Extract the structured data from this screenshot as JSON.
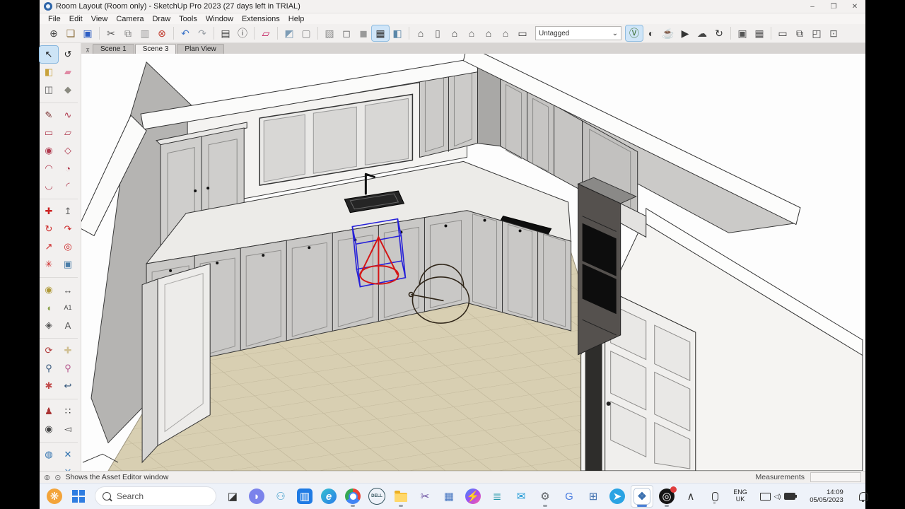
{
  "window": {
    "title": "Room Layout (Room only) - SketchUp Pro 2023 (27 days left in TRIAL)",
    "controls": {
      "minimize": "–",
      "restore": "❐",
      "close": "✕"
    }
  },
  "menu": {
    "items": [
      "File",
      "Edit",
      "View",
      "Camera",
      "Draw",
      "Tools",
      "Window",
      "Extensions",
      "Help"
    ]
  },
  "toolbar": {
    "tag_dropdown": "Untagged",
    "items": [
      {
        "n": "new-icon",
        "g": "⊕",
        "c": "#444"
      },
      {
        "n": "open-icon",
        "g": "❏",
        "c": "#8a6d3b"
      },
      {
        "n": "save-icon",
        "g": "▣",
        "c": "#2f5fc4"
      },
      {
        "sep": true
      },
      {
        "n": "cut-icon",
        "g": "✂",
        "c": "#555"
      },
      {
        "n": "copy-icon",
        "g": "⧉",
        "c": "#777"
      },
      {
        "n": "paste-icon",
        "g": "▥",
        "c": "#999"
      },
      {
        "n": "delete-icon",
        "g": "⊗",
        "c": "#c0392b"
      },
      {
        "sep": true
      },
      {
        "n": "undo-icon",
        "g": "↶",
        "c": "#3f76c9"
      },
      {
        "n": "redo-icon",
        "g": "↷",
        "c": "#9aa0a6"
      },
      {
        "sep": true
      },
      {
        "n": "print-icon",
        "g": "▤",
        "c": "#444"
      },
      {
        "n": "model-info-icon",
        "g": "ⓘ",
        "c": "#555"
      },
      {
        "sep": true
      },
      {
        "n": "rotated-rectangle-icon",
        "g": "▱",
        "c": "#c2185b"
      },
      {
        "sep": true
      },
      {
        "n": "style-textured-cube-icon",
        "g": "◩",
        "c": "#7d9cb5"
      },
      {
        "n": "style-wireframe-icon",
        "g": "▢",
        "c": "#888"
      },
      {
        "sep": true
      },
      {
        "n": "style-xray-icon",
        "g": "▨",
        "c": "#8a8a8a"
      },
      {
        "n": "style-hidden-line-icon",
        "g": "◻",
        "c": "#666"
      },
      {
        "n": "style-shaded-icon",
        "g": "◼",
        "c": "#9a9a9a"
      },
      {
        "n": "style-back-edges-icon",
        "g": "▦",
        "c": "#333",
        "sel": true
      },
      {
        "n": "style-shaded-textures-icon",
        "g": "◧",
        "c": "#5b87a8"
      },
      {
        "sep": true
      },
      {
        "n": "view-iso-icon",
        "g": "⌂",
        "c": "#444"
      },
      {
        "n": "view-cabinet-icon",
        "g": "▯",
        "c": "#666"
      },
      {
        "n": "view-front-icon",
        "g": "⌂",
        "c": "#333"
      },
      {
        "n": "view-top-icon",
        "g": "⌂",
        "c": "#555"
      },
      {
        "n": "view-back-icon",
        "g": "⌂",
        "c": "#444"
      },
      {
        "n": "view-side-icon",
        "g": "⌂",
        "c": "#555"
      },
      {
        "n": "view-plan-icon",
        "g": "▭",
        "c": "#444"
      },
      {
        "tag": true
      },
      {
        "n": "vray-logo-icon",
        "g": "Ⓥ",
        "c": "#3a6d2f",
        "sel": true
      },
      {
        "n": "vray-asset-editor-icon",
        "g": "◐",
        "c": "#444"
      },
      {
        "n": "vray-render-icon",
        "g": "☕",
        "c": "#333"
      },
      {
        "n": "vray-render-interactive-icon",
        "g": "▶",
        "c": "#333"
      },
      {
        "n": "vray-cloud-render-icon",
        "g": "☁",
        "c": "#444"
      },
      {
        "n": "vray-update-icon",
        "g": "↻",
        "c": "#333"
      },
      {
        "sep": true
      },
      {
        "n": "vray-viewport-render-icon",
        "g": "▣",
        "c": "#555"
      },
      {
        "n": "vray-viewport-render-region-icon",
        "g": "▦",
        "c": "#555"
      },
      {
        "sep": true
      },
      {
        "n": "vray-frame-buffer-icon",
        "g": "▭",
        "c": "#444"
      },
      {
        "n": "vray-batch-render-icon",
        "g": "⧉",
        "c": "#444"
      },
      {
        "n": "vray-render-region-icon",
        "g": "◰",
        "c": "#444"
      },
      {
        "n": "vray-lock-camera-icon",
        "g": "⊡",
        "c": "#666"
      }
    ]
  },
  "scene_tabs": {
    "pin_icon": "⊼",
    "tabs": [
      {
        "label": "Scene 1",
        "active": false
      },
      {
        "label": "Scene 3",
        "active": true
      },
      {
        "label": "Plan View",
        "active": false
      }
    ]
  },
  "left_toolbar": {
    "tools": [
      {
        "n": "select-tool",
        "g": "↖",
        "c": "#111",
        "sel": true
      },
      {
        "n": "lasso-select-tool",
        "g": "↺",
        "c": "#222"
      },
      {
        "n": "paint-bucket-tool",
        "g": "◧",
        "c": "#c8a23c"
      },
      {
        "n": "eraser-tool",
        "g": "▰",
        "c": "#e08aa4"
      },
      {
        "n": "make-component-tool",
        "g": "◫",
        "c": "#555"
      },
      {
        "n": "glue-tool",
        "g": "◆",
        "c": "#8a8a80"
      },
      {
        "sep": true
      },
      {
        "n": "line-tool",
        "g": "✎",
        "c": "#7a2f2f"
      },
      {
        "n": "freehand-tool",
        "g": "∿",
        "c": "#b03a4e"
      },
      {
        "n": "rectangle-tool",
        "g": "▭",
        "c": "#b03a4e"
      },
      {
        "n": "rotated-rectangle-tool",
        "g": "▱",
        "c": "#b03a4e"
      },
      {
        "n": "circle-tool",
        "g": "◉",
        "c": "#b03a4e"
      },
      {
        "n": "polygon-tool",
        "g": "◇",
        "c": "#b03a4e"
      },
      {
        "n": "arc-tool",
        "g": "◠",
        "c": "#b03a4e"
      },
      {
        "n": "pie-tool",
        "g": "◔",
        "c": "#b03a4e"
      },
      {
        "n": "two-point-arc-tool",
        "g": "◡",
        "c": "#b03a4e"
      },
      {
        "n": "three-point-arc-tool",
        "g": "◜",
        "c": "#b03a4e"
      },
      {
        "sep": true
      },
      {
        "n": "move-tool",
        "g": "✚",
        "c": "#c22"
      },
      {
        "n": "push-pull-tool",
        "g": "↥",
        "c": "#666"
      },
      {
        "n": "rotate-tool",
        "g": "↻",
        "c": "#c22"
      },
      {
        "n": "follow-me-tool",
        "g": "↷",
        "c": "#c22"
      },
      {
        "n": "scale-tool",
        "g": "↗",
        "c": "#c22"
      },
      {
        "n": "offset-tool",
        "g": "◎",
        "c": "#c22"
      },
      {
        "n": "axes-star-tool",
        "g": "✳",
        "c": "#c22"
      },
      {
        "n": "solid-tools",
        "g": "▣",
        "c": "#4a7da8"
      },
      {
        "sep": true
      },
      {
        "n": "tape-measure-tool",
        "g": "◉",
        "c": "#b09a3a"
      },
      {
        "n": "dimension-tool",
        "g": "↔",
        "c": "#555"
      },
      {
        "n": "protractor-tool",
        "g": "◖",
        "c": "#8aa04a"
      },
      {
        "n": "text-tool",
        "g": "A1",
        "c": "#444"
      },
      {
        "n": "axes-tool",
        "g": "◈",
        "c": "#555"
      },
      {
        "n": "3d-text-tool",
        "g": "A",
        "c": "#555"
      },
      {
        "sep": true
      },
      {
        "n": "orbit-tool",
        "g": "⟳",
        "c": "#b03a3a"
      },
      {
        "n": "pan-tool",
        "g": "✚",
        "c": "#d0bf92"
      },
      {
        "n": "zoom-tool",
        "g": "⚲",
        "c": "#33557a"
      },
      {
        "n": "zoom-window-tool",
        "g": "⚲",
        "c": "#b5568c"
      },
      {
        "n": "zoom-extents-tool",
        "g": "✱",
        "c": "#c24a4a"
      },
      {
        "n": "zoom-previous-tool",
        "g": "↩",
        "c": "#33557a"
      },
      {
        "sep": true
      },
      {
        "n": "position-camera-tool",
        "g": "♟",
        "c": "#a33"
      },
      {
        "n": "walk-tool",
        "g": "∷",
        "c": "#222"
      },
      {
        "n": "look-around-tool",
        "g": "◉",
        "c": "#444"
      },
      {
        "n": "field-of-view-tool",
        "g": "◅",
        "c": "#444"
      },
      {
        "sep": true
      },
      {
        "n": "vray-light-gen-tool",
        "g": "◍",
        "c": "#2c6fad"
      },
      {
        "n": "vray-scatter-tool",
        "g": "✕",
        "c": "#2c6fad"
      },
      {
        "n": "vray-stack-tool",
        "g": "≡",
        "c": "#2c6fad"
      },
      {
        "n": "vray-scatter-settings-tool",
        "g": "✕",
        "c": "#5a8fc0"
      }
    ]
  },
  "status_bar": {
    "geolocation_icon": "⊚",
    "person_icon": "⊙",
    "hint": "Shows the Asset Editor window",
    "measurements_label": "Measurements"
  },
  "taskbar": {
    "search_placeholder": "Search",
    "language_line1": "ENG",
    "language_line2": "UK",
    "time": "14:09",
    "date": "05/05/2023",
    "items": [
      {
        "n": "widgets-icon",
        "kind": "glyph",
        "g": "❋",
        "bg": "#f3a43a",
        "fg": "#fff",
        "shape": "circle"
      },
      {
        "n": "start-button",
        "kind": "start"
      },
      {
        "n": "search-input",
        "kind": "search"
      },
      {
        "n": "task-view-icon",
        "kind": "glyph",
        "g": "◪",
        "fg": "#333"
      },
      {
        "n": "teams-chat-icon",
        "kind": "glyph",
        "g": "◗",
        "bg": "#7b83eb",
        "fg": "#fff",
        "shape": "circle"
      },
      {
        "n": "voice-access-icon",
        "kind": "glyph",
        "g": "⚇",
        "fg": "#3e9cc9"
      },
      {
        "n": "microsoft-store-icon",
        "kind": "glyph",
        "g": "▥",
        "bg": "#1f7be4",
        "fg": "#fff"
      },
      {
        "n": "edge-icon",
        "kind": "glyph",
        "g": "e",
        "cls": "edge-bg",
        "shape": "circle"
      },
      {
        "n": "chrome-icon",
        "kind": "glyph",
        "g": "",
        "cls": "chrome-bg",
        "shape": "circle",
        "running": true
      },
      {
        "n": "dell-icon",
        "kind": "glyph",
        "g": "DELL",
        "cls": "dell-bg",
        "shape": "circle"
      },
      {
        "n": "file-explorer-icon",
        "kind": "folder",
        "running": true
      },
      {
        "n": "snipping-tool-icon",
        "kind": "glyph",
        "g": "✂",
        "fg": "#6a4fa0"
      },
      {
        "n": "photos-icon",
        "kind": "glyph",
        "g": "▦",
        "fg": "#4a78c2"
      },
      {
        "n": "messenger-icon",
        "kind": "glyph",
        "g": "⚡",
        "cls": "mess-bg",
        "shape": "circle"
      },
      {
        "n": "notepad-icon",
        "kind": "glyph",
        "g": "≣",
        "fg": "#2196a8"
      },
      {
        "n": "mail-icon",
        "kind": "glyph",
        "g": "✉",
        "fg": "#1f9ad6"
      },
      {
        "n": "settings-icon",
        "kind": "glyph",
        "g": "⚙",
        "fg": "#5f6368",
        "running": true
      },
      {
        "n": "translate-icon",
        "kind": "glyph",
        "g": "G",
        "fg": "#4a7de0"
      },
      {
        "n": "calculator-icon",
        "kind": "glyph",
        "g": "⊞",
        "fg": "#3f6fae"
      },
      {
        "n": "telegram-icon",
        "kind": "glyph",
        "g": "➤",
        "bg": "#2aa3e3",
        "fg": "#fff",
        "shape": "circle"
      },
      {
        "n": "sketchup-icon",
        "kind": "glyph",
        "g": "❖",
        "cls": "su-bg",
        "active": true,
        "running": true
      },
      {
        "n": "obs-icon",
        "kind": "glyph",
        "g": "◎",
        "bg": "#141414",
        "fg": "#fff",
        "shape": "circle",
        "running": true,
        "badge": true
      },
      {
        "n": "tray-chevron-icon",
        "kind": "glyph",
        "g": "∧",
        "fg": "#333"
      },
      {
        "n": "microphone-icon",
        "kind": "mic"
      },
      {
        "n": "language-indicator",
        "kind": "lang"
      },
      {
        "n": "system-tray-icons",
        "kind": "tray"
      },
      {
        "n": "clock",
        "kind": "clock"
      },
      {
        "n": "notification-bell-icon",
        "kind": "bell"
      }
    ]
  },
  "colors": {
    "selection_blue": "#2620d8",
    "light_gizmo_red": "#d41616",
    "sphere_outline": "#2e2417",
    "floor_tile": "#d8cfb2",
    "tile_line": "#c2b89b",
    "wall_white": "#f5f4f2",
    "wall_gray": "#b5b4b2",
    "cabinet_gray": "#cccbc9",
    "worktop": "#ecebe8",
    "tool_selected_bg": "#cde4f6"
  }
}
